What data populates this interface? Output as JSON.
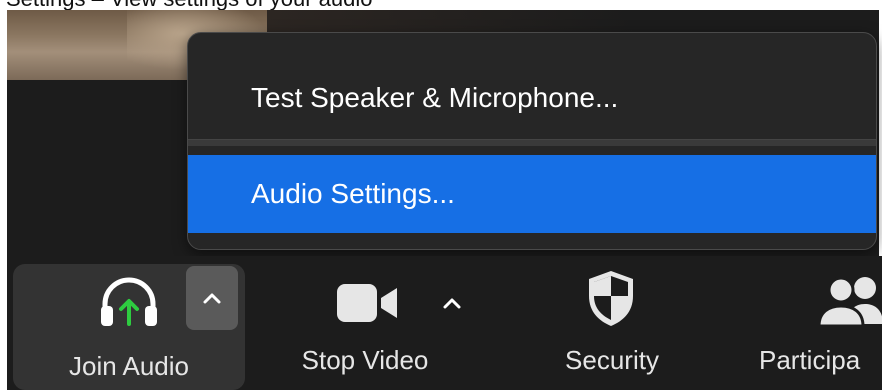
{
  "caption": {
    "text": "Settings – View settings of your audio"
  },
  "menu": {
    "items": [
      {
        "label": "Test Speaker & Microphone..."
      },
      {
        "label": "Audio Settings..."
      }
    ]
  },
  "toolbar": {
    "items": [
      {
        "label": "Join Audio",
        "icon": "headphones-icon"
      },
      {
        "label": "Stop Video",
        "icon": "video-camera-icon"
      },
      {
        "label": "Security",
        "icon": "shield-icon"
      },
      {
        "label": "Participa",
        "icon": "participants-icon"
      }
    ]
  },
  "colors": {
    "menu_highlight": "#166fe5",
    "join_audio_arrow": "#2ecc40",
    "toolbar_bg": "#1c1c1c"
  }
}
